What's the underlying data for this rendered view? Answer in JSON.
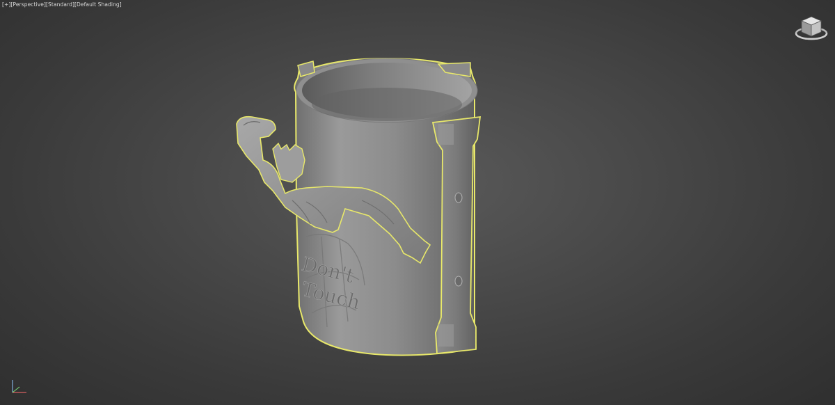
{
  "viewport": {
    "label_plus": "[+]",
    "label_view": "[Perspective]",
    "label_quality": "[Standard]",
    "label_shading": "[Default Shading]"
  },
  "model": {
    "text_line1": "Don't",
    "text_line2": "Touch"
  },
  "icons": {
    "viewcube": "viewcube-icon",
    "axis": "axis-tripod-icon"
  },
  "colors": {
    "selection_outline": "#e8e86a",
    "model_grey": "#8a8a8a",
    "background": "#4a4a4a"
  }
}
